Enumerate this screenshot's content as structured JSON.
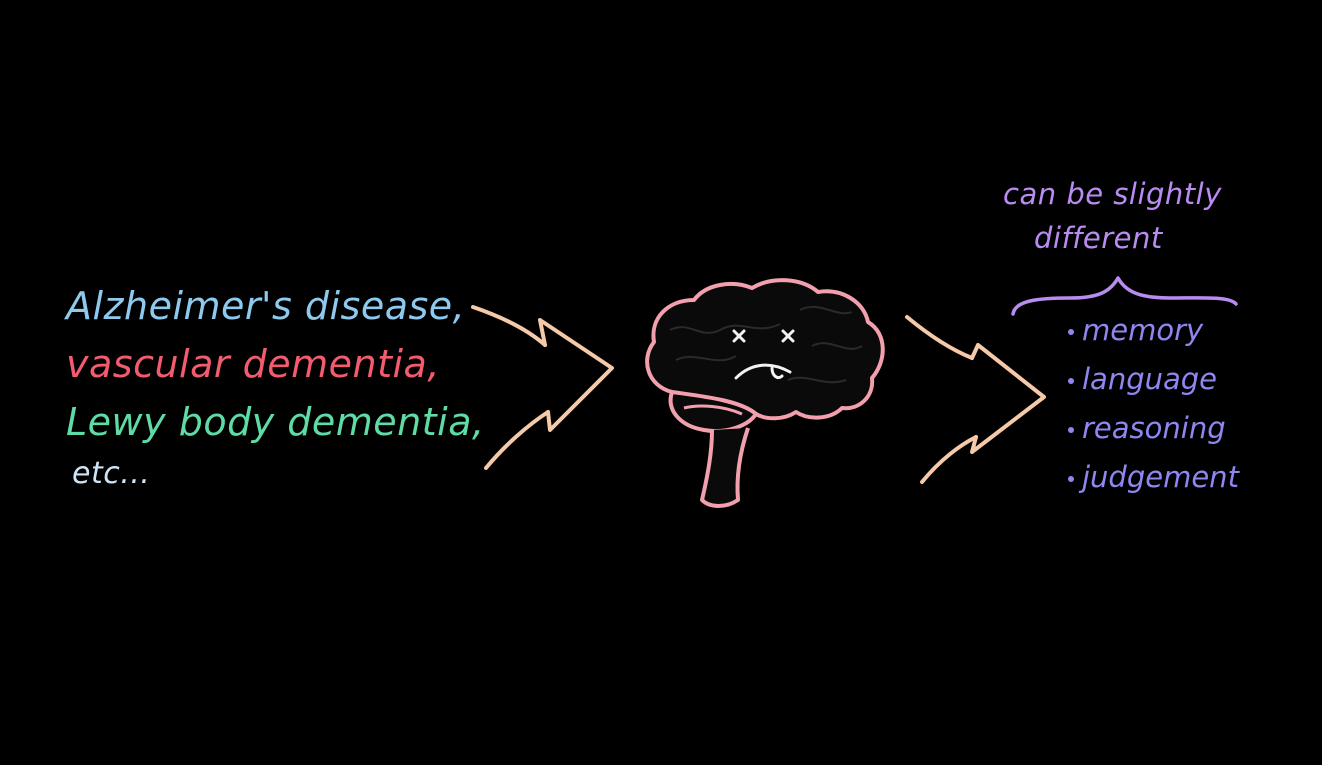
{
  "causes": [
    {
      "label": "Alzheimer's disease,",
      "color": "#8ec9ee"
    },
    {
      "label": "vascular dementia,",
      "color": "#f25c6e"
    },
    {
      "label": "Lewy body dementia,",
      "color": "#5fdca6"
    },
    {
      "label": "etc...",
      "color": "#cfe3f5"
    }
  ],
  "note": {
    "line1": "can be slightly",
    "line2": "different",
    "color": "#b98cf2"
  },
  "symptoms": {
    "color": "#8f86f0",
    "items": [
      "memory",
      "language",
      "reasoning",
      "judgement"
    ]
  },
  "colors": {
    "background": "#000000",
    "arrow": "#f6c9a8",
    "brain_outline": "#f2a0ae",
    "brain_face": "#f2f2f2",
    "brace": "#b98cf2"
  },
  "icons": {
    "left_arrow": "converging-arrow-icon",
    "right_arrow": "diverging-arrow-icon",
    "brain": "sad-brain-icon",
    "brace": "curly-brace-icon"
  }
}
